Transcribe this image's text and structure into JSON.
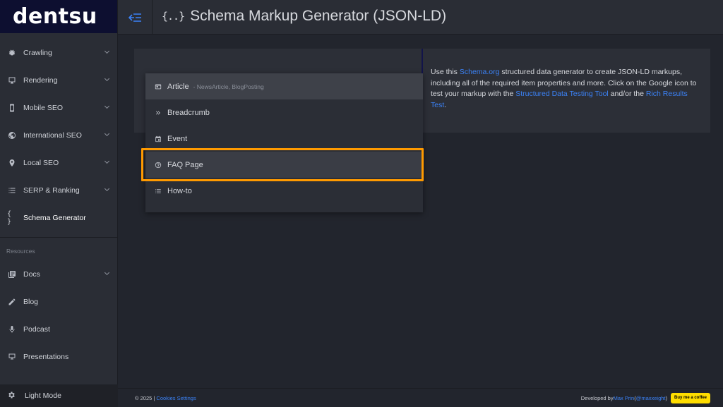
{
  "brand": {
    "logo_text": "dentsu"
  },
  "sidebar": {
    "items": [
      {
        "label": "Crawling",
        "icon": "bug-icon",
        "chevron": true
      },
      {
        "label": "Rendering",
        "icon": "monitor-icon",
        "chevron": true
      },
      {
        "label": "Mobile SEO",
        "icon": "phone-icon",
        "chevron": true
      },
      {
        "label": "International SEO",
        "icon": "globe-icon",
        "chevron": true
      },
      {
        "label": "Local SEO",
        "icon": "pin-icon",
        "chevron": true
      },
      {
        "label": "SERP & Ranking",
        "icon": "list-icon",
        "chevron": true
      },
      {
        "label": "Schema Generator",
        "icon": "braces-icon",
        "chevron": false,
        "active": true
      }
    ],
    "section_label": "Resources",
    "resources": [
      {
        "label": "Docs",
        "icon": "docs-icon",
        "chevron": true
      },
      {
        "label": "Blog",
        "icon": "pencil-icon",
        "chevron": false
      },
      {
        "label": "Podcast",
        "icon": "mic-icon",
        "chevron": false
      },
      {
        "label": "Presentations",
        "icon": "presentation-icon",
        "chevron": false
      }
    ],
    "light_mode_label": "Light Mode"
  },
  "header": {
    "title_icon": "{..}",
    "title": "Schema Markup Generator (JSON-LD)"
  },
  "dropdown": {
    "options": [
      {
        "label": "Article",
        "sub": "- NewsArticle, BlogPosting",
        "icon": "article-icon",
        "selected": true
      },
      {
        "label": "Breadcrumb",
        "sub": "",
        "icon": "double-chevron-icon"
      },
      {
        "label": "Event",
        "sub": "",
        "icon": "calendar-icon"
      },
      {
        "label": "FAQ Page",
        "sub": "",
        "icon": "question-icon",
        "highlighted": true
      },
      {
        "label": "How-to",
        "sub": "",
        "icon": "list-icon"
      }
    ]
  },
  "description": {
    "t1": "Use this ",
    "link1": "Schema.org",
    "t2": " structured data generator to create JSON-LD markups, including all of the required item properties and more. Click on the Google icon to test your markup with the ",
    "link2": "Structured Data Testing Tool",
    "t3": " and/or the ",
    "link3": "Rich Results Test",
    "t4": "."
  },
  "footer": {
    "copyright": "© 2025 | ",
    "cookies_link": "Cookies Settings",
    "developed_by": "Developed by ",
    "author_link": "Max Prin",
    "handle_open": " (",
    "handle_link": "@maxxeight",
    "handle_close": ")",
    "coffee_label": "Buy me a coffee"
  },
  "colors": {
    "accent_link": "#3b82f6",
    "highlight_border": "#ff9a00",
    "logo_bg": "#0d0f30",
    "coffee_bg": "#ffdd00"
  }
}
